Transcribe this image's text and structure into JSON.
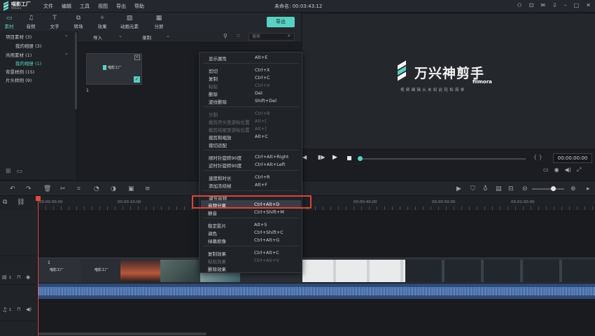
{
  "app": {
    "logo_name": "喵影工厂",
    "logo_sub": "filmora",
    "menu": [
      "文件",
      "编辑",
      "工具",
      "视图",
      "导出",
      "帮助"
    ],
    "project_label": "未命名: 00:03:43:12"
  },
  "toolbar": {
    "tabs": [
      "素材",
      "音频",
      "文字",
      "转场",
      "效果",
      "动画元素",
      "分屏"
    ],
    "export_label": "导出"
  },
  "left_panel": {
    "items": [
      "项目素材 (3)",
      "我的相册 (3)",
      "共用素材 (1)",
      "我的相册 (1)",
      "背景样例 (15)",
      "片头样例 (9)"
    ]
  },
  "media_bar": {
    "import_label": "导入",
    "record_label": "录制",
    "search_placeholder": "搜索"
  },
  "media": {
    "thumb_brand": "喵影工厂",
    "thumb_index": "1"
  },
  "preview": {
    "brand_title": "万兴神剪手",
    "brand_en": "filmora",
    "tagline": "视频编辑从未如此轻松简单",
    "timecode": "00:00:00:00"
  },
  "ruler": [
    "00:00:00:00",
    "00:00:10:00",
    "00:00:40:00",
    "00:00:50:00",
    "00:01:00:00"
  ],
  "track": {
    "video_index": "1",
    "audio_index": "1",
    "clip_index": "1",
    "clip_brand": "喵影工厂"
  },
  "context_menu": {
    "items": [
      {
        "label": "显示属性",
        "shortcut": "Alt+E",
        "enabled": true
      },
      {
        "label": "剪切",
        "shortcut": "Ctrl+X",
        "enabled": true
      },
      {
        "label": "复制",
        "shortcut": "Ctrl+C",
        "enabled": true
      },
      {
        "label": "粘贴",
        "shortcut": "Ctrl+V",
        "enabled": false
      },
      {
        "label": "删除",
        "shortcut": "Del",
        "enabled": true
      },
      {
        "label": "波纹删除",
        "shortcut": "Shift+Del",
        "enabled": true
      },
      {
        "label": "分割",
        "shortcut": "Ctrl+B",
        "enabled": false
      },
      {
        "label": "截剪开头至游标位置",
        "shortcut": "Alt+[",
        "enabled": false
      },
      {
        "label": "截剪结尾至游标位置",
        "shortcut": "Alt+]",
        "enabled": false
      },
      {
        "label": "裁剪和缩放",
        "shortcut": "Alt+C",
        "enabled": true
      },
      {
        "label": "裁切适配",
        "shortcut": "",
        "enabled": true
      },
      {
        "label": "顺时针旋转90度",
        "shortcut": "Ctrl+Alt+Right",
        "enabled": true
      },
      {
        "label": "逆时针旋转90度",
        "shortcut": "Ctrl+Alt+Left",
        "enabled": true
      },
      {
        "label": "速度和时长",
        "shortcut": "Ctrl+R",
        "enabled": true
      },
      {
        "label": "添加冻结帧",
        "shortcut": "Alt+F",
        "enabled": true
      },
      {
        "label": "调节音频",
        "shortcut": "",
        "enabled": true
      },
      {
        "label": "音频分离",
        "shortcut": "Ctrl+Alt+D",
        "enabled": true
      },
      {
        "label": "静音",
        "shortcut": "Ctrl+Shift+M",
        "enabled": true
      },
      {
        "label": "稳定影片",
        "shortcut": "Alt+S",
        "enabled": true
      },
      {
        "label": "调色",
        "shortcut": "Ctrl+Shift+C",
        "enabled": true
      },
      {
        "label": "绿幕抠像",
        "shortcut": "Ctrl+Alt+G",
        "enabled": true
      },
      {
        "label": "复制效果",
        "shortcut": "Ctrl+Alt+C",
        "enabled": true
      },
      {
        "label": "粘贴效果",
        "shortcut": "Ctrl+Alt+V",
        "enabled": false
      },
      {
        "label": "删除效果",
        "shortcut": "",
        "enabled": true
      }
    ]
  },
  "colors": {
    "accent": "#58d1c1",
    "highlight_box": "#d9453a",
    "audio_wave": "#5a7fb8"
  }
}
